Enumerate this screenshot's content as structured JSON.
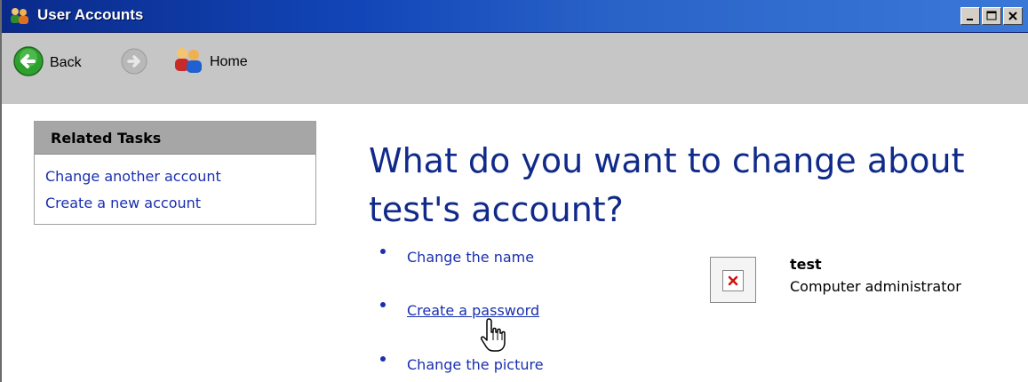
{
  "window": {
    "title": "User Accounts",
    "icons": [
      "users-icon",
      "minimize-icon",
      "maximize-icon",
      "close-icon"
    ]
  },
  "toolbar": {
    "back_label": "Back",
    "home_label": "Home",
    "icons": [
      "back-arrow-icon",
      "forward-arrow-icon",
      "home-users-icon"
    ]
  },
  "related_tasks": {
    "title": "Related Tasks",
    "links": [
      {
        "label": "Change another account"
      },
      {
        "label": "Create a new account"
      }
    ]
  },
  "main": {
    "heading_line1": "What do you want to change about",
    "heading_line2": "test's account?",
    "options": [
      {
        "label": "Change the name"
      },
      {
        "label": "Create a password"
      },
      {
        "label": "Change the picture"
      }
    ]
  },
  "account": {
    "name": "test",
    "role": "Computer administrator",
    "picture_icon": "broken-image-icon"
  },
  "colors": {
    "title_bar": "#1246b8",
    "link": "#1a2fb0",
    "heading": "#102a8a",
    "toolbar_bg": "#c6c6c6",
    "tasks_header_bg": "#a6a6a6"
  }
}
